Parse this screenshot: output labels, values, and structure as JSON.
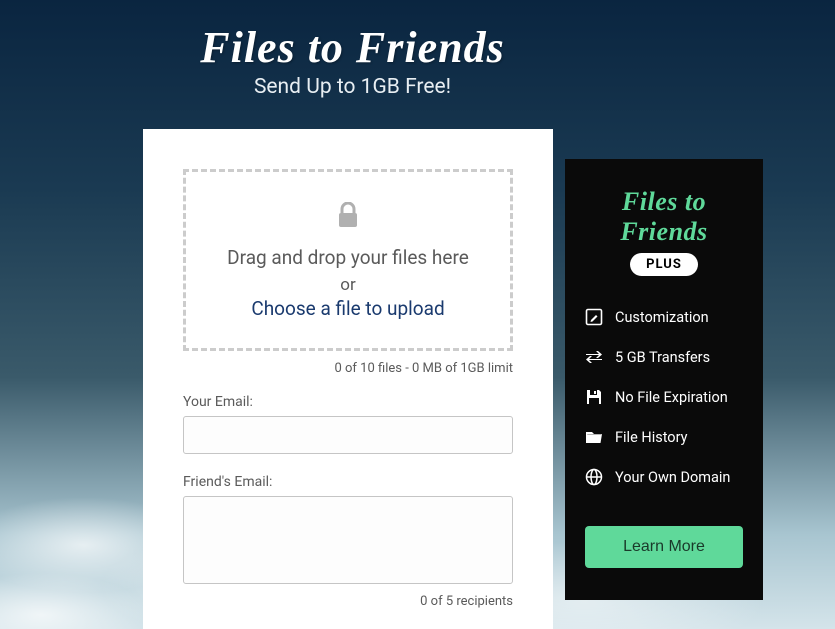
{
  "header": {
    "title": "Files to Friends",
    "subtitle": "Send Up to 1GB Free!"
  },
  "upload": {
    "drop_main": "Drag and drop your files here",
    "drop_or": "or",
    "choose_link": "Choose a file to upload",
    "file_status": "0 of 10 files - 0 MB of 1GB limit",
    "your_email_label": "Your Email:",
    "friends_email_label": "Friend's Email:",
    "recipients_status": "0 of 5 recipients"
  },
  "plus": {
    "title": "Files to Friends",
    "badge": "PLUS",
    "features": [
      {
        "icon": "edit-icon",
        "label": "Customization"
      },
      {
        "icon": "transfer-icon",
        "label": "5 GB Transfers"
      },
      {
        "icon": "save-icon",
        "label": "No File Expiration"
      },
      {
        "icon": "folder-icon",
        "label": "File History"
      },
      {
        "icon": "globe-icon",
        "label": "Your Own Domain"
      }
    ],
    "cta": "Learn More"
  }
}
